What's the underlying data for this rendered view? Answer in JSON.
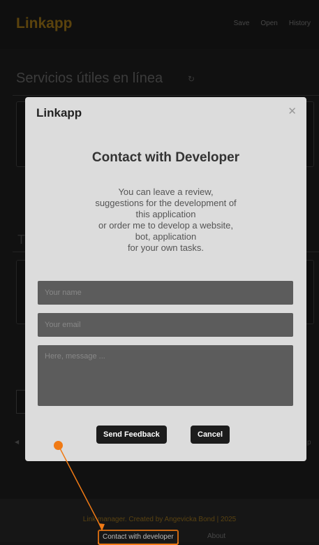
{
  "app": {
    "brand": "Linkapp",
    "nav": [
      "Save",
      "Open",
      "History"
    ],
    "page_title": "Servicios útiles en línea",
    "side_letter": "T"
  },
  "modal": {
    "title": "Linkapp",
    "heading": "Contact with Developer",
    "description": "You can leave a review,\nsuggestions for the development of\nthis application\nor order me to develop a website,\nbot, application\nfor your own tasks.",
    "name_placeholder": "Your name",
    "email_placeholder": "Your email",
    "message_placeholder": "Here, message ...",
    "send_label": "Send Feedback",
    "cancel_label": "Cancel"
  },
  "footer": {
    "text": "Link manager. Created by Angevicka Bond | 2025",
    "contact_label": "Contact with developer",
    "about_label": "About"
  },
  "colors": {
    "accent": "#f07a15",
    "brand": "#6b4f10"
  }
}
